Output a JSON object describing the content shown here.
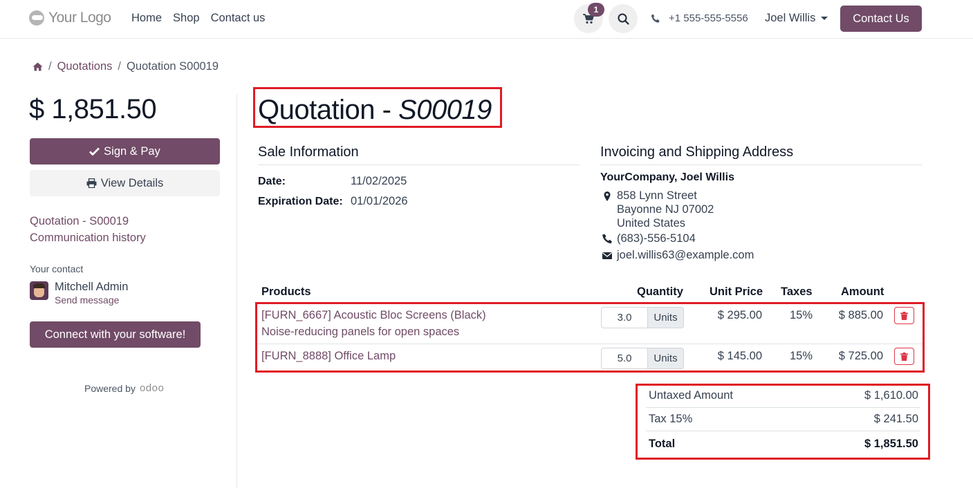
{
  "header": {
    "logo_text": "Your Logo",
    "nav": [
      "Home",
      "Shop",
      "Contact us"
    ],
    "cart_count": "1",
    "phone": "+1 555-555-5556",
    "user_name": "Joel Willis",
    "contact_button": "Contact Us"
  },
  "breadcrumb": {
    "items": [
      "Quotations",
      "Quotation S00019"
    ]
  },
  "sidebar": {
    "total": "$ 1,851.50",
    "sign_pay_label": "Sign & Pay",
    "view_details_label": "View Details",
    "links": [
      "Quotation - S00019",
      "Communication history"
    ],
    "your_contact_label": "Your contact",
    "contact_name": "Mitchell Admin",
    "send_message": "Send message",
    "connect_label": "Connect with your software!",
    "powered_by": "Powered by",
    "odoo_text": "odoo"
  },
  "main": {
    "title_prefix": "Quotation - ",
    "title_ref": "S00019",
    "sale_info": {
      "heading": "Sale Information",
      "date_label": "Date:",
      "date_value": "11/02/2025",
      "exp_label": "Expiration Date:",
      "exp_value": "01/01/2026"
    },
    "address": {
      "heading": "Invoicing and Shipping Address",
      "name": "YourCompany, Joel Willis",
      "street": "858 Lynn Street",
      "city": "Bayonne NJ 07002",
      "country": "United States",
      "phone": "(683)-556-5104",
      "email": "joel.willis63@example.com"
    },
    "table": {
      "headers": [
        "Products",
        "Quantity",
        "Unit Price",
        "Taxes",
        "Amount"
      ],
      "rows": [
        {
          "name": "[FURN_6667] Acoustic Bloc Screens (Black)",
          "description": "Noise-reducing panels for open spaces",
          "qty": "3.0",
          "unit": "Units",
          "unit_price": "$ 295.00",
          "taxes": "15%",
          "amount": "$ 885.00"
        },
        {
          "name": "[FURN_8888] Office Lamp",
          "qty": "5.0",
          "unit": "Units",
          "unit_price": "$ 145.00",
          "taxes": "15%",
          "amount": "$ 725.00"
        }
      ]
    },
    "totals": {
      "untaxed_label": "Untaxed Amount",
      "untaxed_value": "$ 1,610.00",
      "tax_label": "Tax 15%",
      "tax_value": "$ 241.50",
      "total_label": "Total",
      "total_value": "$ 1,851.50"
    }
  },
  "colors": {
    "brand": "#714b67",
    "highlight": "#e01b24",
    "danger": "#dc3545"
  }
}
